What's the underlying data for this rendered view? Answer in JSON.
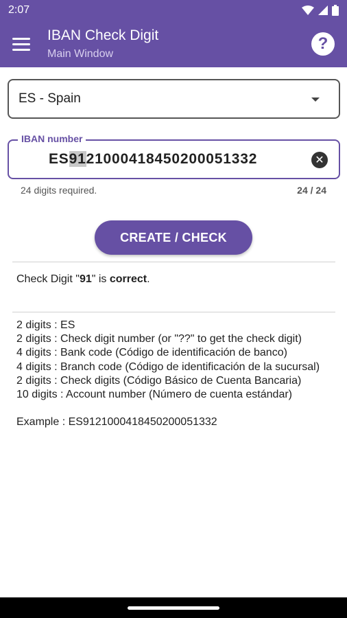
{
  "status_bar": {
    "time": "2:07"
  },
  "app_bar": {
    "title": "IBAN Check Digit",
    "subtitle": "Main Window"
  },
  "country_select": {
    "value": "ES - Spain"
  },
  "iban_field": {
    "label": "IBAN number",
    "prefix": "ES",
    "check_digit": "91",
    "rest": "21000418450200051332",
    "helper": "24 digits required.",
    "counter": "24 / 24"
  },
  "cta_label": "CREATE / CHECK",
  "result": {
    "prefix": "Check Digit \"",
    "digit": "91",
    "middle": "\" is ",
    "status": "correct",
    "suffix": "."
  },
  "info_lines": [
    "2 digits : ES",
    "2 digits : Check digit number (or \"??\" to get the check digit)",
    "4 digits : Bank code (Código de identificación de banco)",
    "4 digits : Branch code (Código de identificación de la sucursal)",
    "2 digits : Check digits (Código Básico de Cuenta Bancaria)",
    "10 digits : Account number (Número de cuenta estándar)"
  ],
  "example": "Example : ES9121000418450200051332",
  "colors": {
    "primary": "#6650a4",
    "on_primary": "#ffffff"
  }
}
